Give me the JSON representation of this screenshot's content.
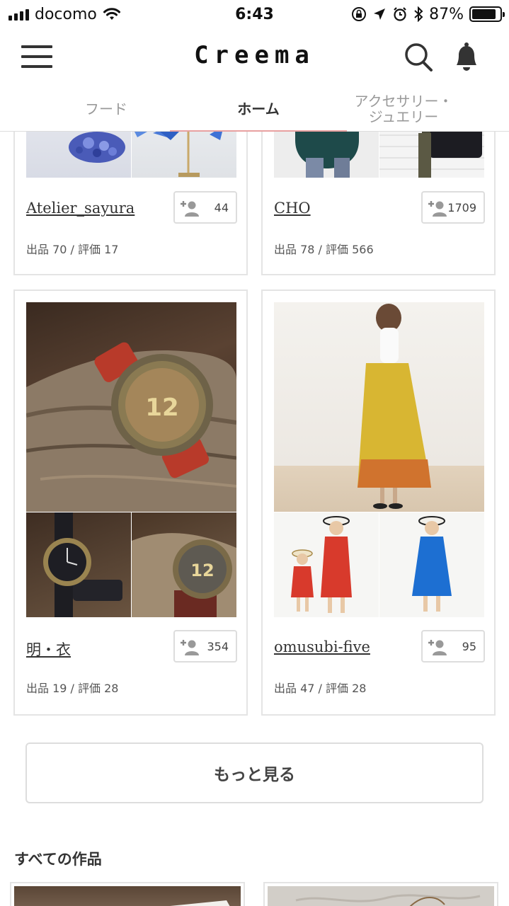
{
  "status_bar": {
    "carrier": "docomo",
    "time": "6:43",
    "battery_percent": "87%",
    "battery_level": 0.87
  },
  "header": {
    "logo": "Creema",
    "menu_icon": "hamburger-icon",
    "search_icon": "search-icon",
    "bell_icon": "bell-icon"
  },
  "tabs": [
    {
      "label": "フード",
      "active": false
    },
    {
      "label": "ホーム",
      "active": true
    },
    {
      "label": "アクセサリー・ジュエリー",
      "active": false
    }
  ],
  "creators": [
    {
      "name": "Atelier_sayura",
      "followers": "44",
      "stats": "出品 70 / 評価 17"
    },
    {
      "name": "CHO",
      "followers": "1709",
      "stats": "出品 78 / 評価 566"
    },
    {
      "name": "明・衣",
      "followers": "354",
      "stats": "出品 19 / 評価 28"
    },
    {
      "name": "omusubi-five",
      "followers": "95",
      "stats": "出品 47 / 評価 28"
    }
  ],
  "more_button": "もっと見る",
  "section_title": "すべての作品",
  "colors": {
    "tab_underline": "#e8a0a0",
    "border": "#e4e4e4"
  }
}
